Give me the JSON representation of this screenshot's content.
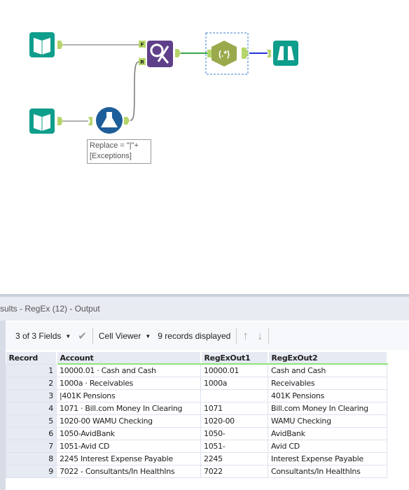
{
  "canvas": {
    "annotation": "Replace = \"|\"+ [Exceptions]",
    "tools": [
      {
        "name": "Input Data"
      },
      {
        "name": "Input Data"
      },
      {
        "name": "Formula"
      },
      {
        "name": "Find Replace",
        "anchors": [
          "F",
          "R"
        ]
      },
      {
        "name": "RegEx",
        "glyph": "(.*)"
      },
      {
        "name": "Browse"
      }
    ],
    "colors": {
      "input": "#0f9e8c",
      "find_replace": "#5f3f8a",
      "regex": "#9aa94b",
      "formula": "#1d5e9a"
    }
  },
  "panel": {
    "title": "sults - RegEx (12) - Output",
    "fields": "3 of 3 Fields",
    "viewer": "Cell Viewer",
    "records": "9 records displayed"
  },
  "table": {
    "headers": [
      "Record",
      "Account",
      "RegExOut1",
      "RegExOut2"
    ],
    "rows": [
      [
        "1",
        "10000.01 · Cash and Cash",
        "10000.01",
        "Cash and Cash"
      ],
      [
        "2",
        "1000a · Receivables",
        "1000a",
        "Receivables"
      ],
      [
        "3",
        "|401K Pensions",
        "",
        "401K Pensions"
      ],
      [
        "4",
        "1071 · Bill.com Money In Clearing",
        "1071",
        "Bill.com Money In Clearing"
      ],
      [
        "5",
        "1020-00 WAMU Checking",
        "1020-00",
        "WAMU Checking"
      ],
      [
        "6",
        "1050-AvidBank",
        "1050-",
        "AvidBank"
      ],
      [
        "7",
        "1051-Avid CD",
        "1051-",
        "Avid CD"
      ],
      [
        "8",
        "2245 Interest Expense Payable",
        "2245",
        "Interest Expense Payable"
      ],
      [
        "9",
        "7022 - Consultants/In HealthIns",
        "7022",
        "Consultants/In HealthIns"
      ]
    ]
  }
}
